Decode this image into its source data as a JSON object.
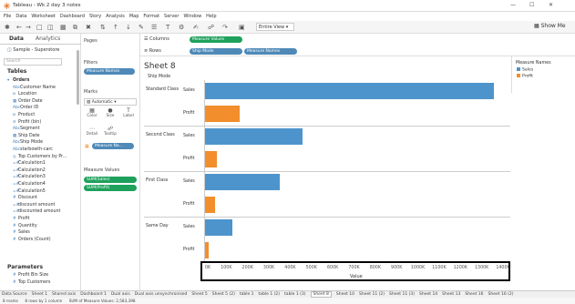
{
  "app": {
    "title": "Tableau - Wk 2 day 3 notes"
  },
  "menu": [
    "File",
    "Data",
    "Worksheet",
    "Dashboard",
    "Story",
    "Analysis",
    "Map",
    "Format",
    "Server",
    "Window",
    "Help"
  ],
  "toolbar": {
    "view_select": "Entire View",
    "show_me": "Show Me"
  },
  "left": {
    "tab_data": "Data",
    "tab_analytics": "Analytics",
    "datasource": "Sample - Superstore",
    "search_placeholder": "Search",
    "tables_header": "Tables",
    "fields": [
      {
        "label": "Orders",
        "icon": "table-icon"
      },
      {
        "label": "Customer Name",
        "icon": "abc"
      },
      {
        "label": "Location",
        "icon": "hierarchy"
      },
      {
        "label": "Order Date",
        "icon": "date"
      },
      {
        "label": "Order ID",
        "icon": "abc"
      },
      {
        "label": "Product",
        "icon": "hierarchy"
      },
      {
        "label": "Profit (bin)",
        "icon": "bin"
      },
      {
        "label": "Segment",
        "icon": "abc"
      },
      {
        "label": "Ship Date",
        "icon": "date"
      },
      {
        "label": "Ship Mode",
        "icon": "abc"
      },
      {
        "label": "starbowth-carc",
        "icon": "abc"
      },
      {
        "label": "Top Customers by Pr...",
        "icon": "set"
      },
      {
        "label": "Calculation1",
        "icon": "=#"
      },
      {
        "label": "Calculation2",
        "icon": "=#"
      },
      {
        "label": "Calculation3",
        "icon": "=#"
      },
      {
        "label": "Calculation4",
        "icon": "=#"
      },
      {
        "label": "Calculation5",
        "icon": "=#"
      },
      {
        "label": "Discount",
        "icon": "#"
      },
      {
        "label": "discount amount",
        "icon": "=#"
      },
      {
        "label": "discounted amount",
        "icon": "=#"
      },
      {
        "label": "Profit",
        "icon": "#"
      },
      {
        "label": "Quantity",
        "icon": "#"
      },
      {
        "label": "Sales",
        "icon": "#"
      },
      {
        "label": "Orders (Count)",
        "icon": "#"
      }
    ],
    "parameters_header": "Parameters",
    "parameters": [
      "Profit Bin Size",
      "Top Customers"
    ]
  },
  "mid": {
    "pages": "Pages",
    "filters": "Filters",
    "filter_pill": "Measure Names",
    "marks": "Marks",
    "marks_type": "Automatic",
    "mark_buttons": [
      "Color",
      "Size",
      "Label",
      "Detail",
      "Tooltip"
    ],
    "marks_pill": "Measure Na...",
    "measure_values": "Measure Values",
    "mv_pills": [
      "SUM(Sales)",
      "SUM(Profit)"
    ]
  },
  "shelves": {
    "columns_label": "Columns",
    "columns_pill": "Measure Values",
    "rows_label": "Rows",
    "rows_pills": [
      "Ship Mode",
      "Measure Names"
    ]
  },
  "sheet": {
    "title": "Sheet 8",
    "row_header": "Ship Mode",
    "axis_title": "Value",
    "ticks": [
      "0K",
      "100K",
      "200K",
      "300K",
      "400K",
      "500K",
      "600K",
      "700K",
      "800K",
      "900K",
      "1000K",
      "1100K",
      "1200K",
      "1300K",
      "1400K"
    ]
  },
  "legend": {
    "title": "Measure Names",
    "items": [
      {
        "label": "Sales",
        "color": "#4e94cc"
      },
      {
        "label": "Profit",
        "color": "#f28e2b"
      }
    ]
  },
  "chart_data": {
    "type": "bar",
    "orientation": "horizontal",
    "categories": [
      "Standard Class",
      "Second Class",
      "First Class",
      "Same Day"
    ],
    "series": [
      {
        "name": "Sales",
        "values": [
          1358000,
          459000,
          351000,
          128000
        ],
        "color": "#4e94cc"
      },
      {
        "name": "Profit",
        "values": [
          164000,
          57000,
          49000,
          16000
        ],
        "color": "#f28e2b"
      }
    ],
    "xlim": [
      0,
      1400000
    ],
    "xlabel": "Value",
    "ylabel": "Ship Mode"
  },
  "sheet_tabs": [
    "Data Source",
    "Sheet 1",
    "Shared axis",
    "Dashboard 1",
    "Dual axis",
    "Dual axis unsynchronised",
    "Sheet 5",
    "Sheet 5 (2)",
    "table 1",
    "table 1 (2)",
    "table 1 (3)",
    "Sheet 8",
    "Sheet 10",
    "Sheet 11 (2)",
    "Sheet 11 (3)",
    "Sheet 14",
    "Sheet 13",
    "Sheet 16",
    "Sheet 16 (2)"
  ],
  "status": [
    "8 marks",
    "8 rows by 1 column",
    "SUM of Measure Values: 2,583,398"
  ]
}
